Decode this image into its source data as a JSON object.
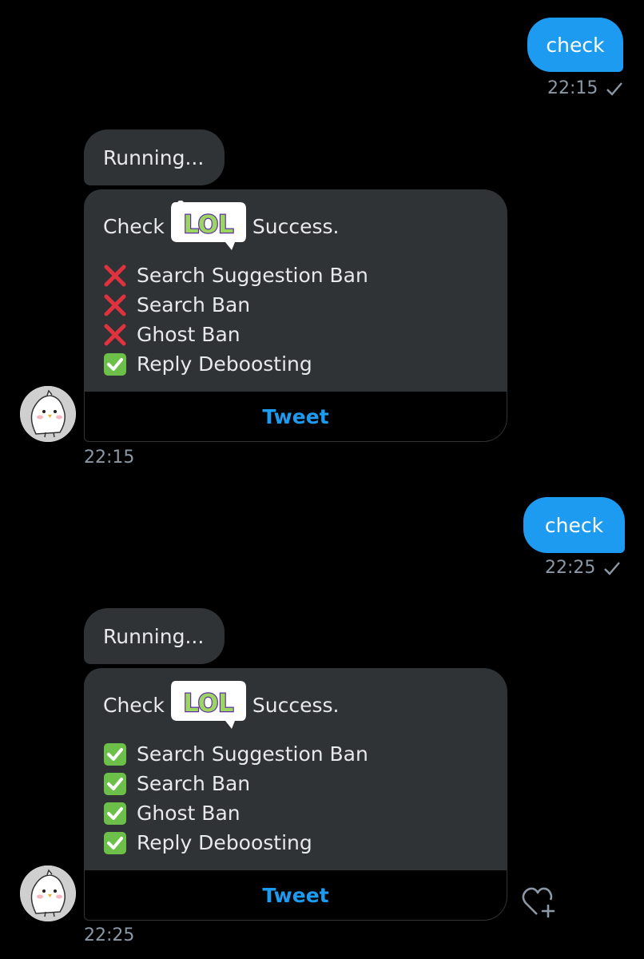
{
  "conversation": [
    {
      "outgoing": {
        "text": "check",
        "time": "22:15"
      },
      "incoming": {
        "running_text": "Running...",
        "card": {
          "check_text": "Check",
          "sticker_label": "LOL",
          "success_text": "Success.",
          "items": [
            {
              "status": "fail",
              "label": "Search Suggestion Ban"
            },
            {
              "status": "fail",
              "label": "Search Ban"
            },
            {
              "status": "fail",
              "label": "Ghost Ban"
            },
            {
              "status": "pass",
              "label": "Reply Deboosting"
            }
          ],
          "button_label": "Tweet"
        },
        "time": "22:15"
      }
    },
    {
      "outgoing": {
        "text": "check",
        "time": "22:25"
      },
      "incoming": {
        "running_text": "Running...",
        "card": {
          "check_text": "Check",
          "sticker_label": "LOL",
          "success_text": "Success.",
          "items": [
            {
              "status": "pass",
              "label": "Search Suggestion Ban"
            },
            {
              "status": "pass",
              "label": "Search Ban"
            },
            {
              "status": "pass",
              "label": "Ghost Ban"
            },
            {
              "status": "pass",
              "label": "Reply Deboosting"
            }
          ],
          "button_label": "Tweet"
        },
        "time": "22:25"
      }
    }
  ],
  "icons": {
    "read_receipt": "check-icon",
    "fail": "cross-mark-icon",
    "pass": "check-box-icon",
    "reaction": "heart-plus-icon",
    "avatar": "chick-avatar-icon"
  },
  "colors": {
    "background": "#000000",
    "outgoing_bubble": "#1d9bf0",
    "incoming_bubble": "#2f3336",
    "link": "#1d9bf0",
    "fail": "#e0323e",
    "pass": "#6cc04a",
    "meta_text": "#8b98a5"
  }
}
